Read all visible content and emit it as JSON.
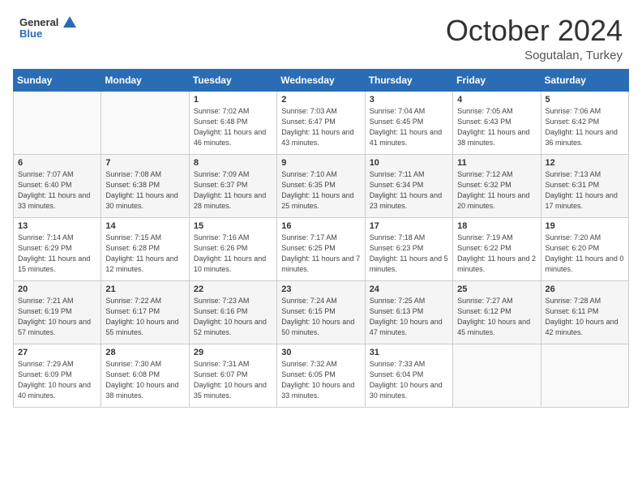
{
  "header": {
    "logo_general": "General",
    "logo_blue": "Blue",
    "title": "October 2024",
    "location": "Sogutalan, Turkey"
  },
  "weekdays": [
    "Sunday",
    "Monday",
    "Tuesday",
    "Wednesday",
    "Thursday",
    "Friday",
    "Saturday"
  ],
  "weeks": [
    [
      {
        "day": "",
        "sunrise": "",
        "sunset": "",
        "daylight": ""
      },
      {
        "day": "",
        "sunrise": "",
        "sunset": "",
        "daylight": ""
      },
      {
        "day": "1",
        "sunrise": "Sunrise: 7:02 AM",
        "sunset": "Sunset: 6:48 PM",
        "daylight": "Daylight: 11 hours and 46 minutes."
      },
      {
        "day": "2",
        "sunrise": "Sunrise: 7:03 AM",
        "sunset": "Sunset: 6:47 PM",
        "daylight": "Daylight: 11 hours and 43 minutes."
      },
      {
        "day": "3",
        "sunrise": "Sunrise: 7:04 AM",
        "sunset": "Sunset: 6:45 PM",
        "daylight": "Daylight: 11 hours and 41 minutes."
      },
      {
        "day": "4",
        "sunrise": "Sunrise: 7:05 AM",
        "sunset": "Sunset: 6:43 PM",
        "daylight": "Daylight: 11 hours and 38 minutes."
      },
      {
        "day": "5",
        "sunrise": "Sunrise: 7:06 AM",
        "sunset": "Sunset: 6:42 PM",
        "daylight": "Daylight: 11 hours and 36 minutes."
      }
    ],
    [
      {
        "day": "6",
        "sunrise": "Sunrise: 7:07 AM",
        "sunset": "Sunset: 6:40 PM",
        "daylight": "Daylight: 11 hours and 33 minutes."
      },
      {
        "day": "7",
        "sunrise": "Sunrise: 7:08 AM",
        "sunset": "Sunset: 6:38 PM",
        "daylight": "Daylight: 11 hours and 30 minutes."
      },
      {
        "day": "8",
        "sunrise": "Sunrise: 7:09 AM",
        "sunset": "Sunset: 6:37 PM",
        "daylight": "Daylight: 11 hours and 28 minutes."
      },
      {
        "day": "9",
        "sunrise": "Sunrise: 7:10 AM",
        "sunset": "Sunset: 6:35 PM",
        "daylight": "Daylight: 11 hours and 25 minutes."
      },
      {
        "day": "10",
        "sunrise": "Sunrise: 7:11 AM",
        "sunset": "Sunset: 6:34 PM",
        "daylight": "Daylight: 11 hours and 23 minutes."
      },
      {
        "day": "11",
        "sunrise": "Sunrise: 7:12 AM",
        "sunset": "Sunset: 6:32 PM",
        "daylight": "Daylight: 11 hours and 20 minutes."
      },
      {
        "day": "12",
        "sunrise": "Sunrise: 7:13 AM",
        "sunset": "Sunset: 6:31 PM",
        "daylight": "Daylight: 11 hours and 17 minutes."
      }
    ],
    [
      {
        "day": "13",
        "sunrise": "Sunrise: 7:14 AM",
        "sunset": "Sunset: 6:29 PM",
        "daylight": "Daylight: 11 hours and 15 minutes."
      },
      {
        "day": "14",
        "sunrise": "Sunrise: 7:15 AM",
        "sunset": "Sunset: 6:28 PM",
        "daylight": "Daylight: 11 hours and 12 minutes."
      },
      {
        "day": "15",
        "sunrise": "Sunrise: 7:16 AM",
        "sunset": "Sunset: 6:26 PM",
        "daylight": "Daylight: 11 hours and 10 minutes."
      },
      {
        "day": "16",
        "sunrise": "Sunrise: 7:17 AM",
        "sunset": "Sunset: 6:25 PM",
        "daylight": "Daylight: 11 hours and 7 minutes."
      },
      {
        "day": "17",
        "sunrise": "Sunrise: 7:18 AM",
        "sunset": "Sunset: 6:23 PM",
        "daylight": "Daylight: 11 hours and 5 minutes."
      },
      {
        "day": "18",
        "sunrise": "Sunrise: 7:19 AM",
        "sunset": "Sunset: 6:22 PM",
        "daylight": "Daylight: 11 hours and 2 minutes."
      },
      {
        "day": "19",
        "sunrise": "Sunrise: 7:20 AM",
        "sunset": "Sunset: 6:20 PM",
        "daylight": "Daylight: 11 hours and 0 minutes."
      }
    ],
    [
      {
        "day": "20",
        "sunrise": "Sunrise: 7:21 AM",
        "sunset": "Sunset: 6:19 PM",
        "daylight": "Daylight: 10 hours and 57 minutes."
      },
      {
        "day": "21",
        "sunrise": "Sunrise: 7:22 AM",
        "sunset": "Sunset: 6:17 PM",
        "daylight": "Daylight: 10 hours and 55 minutes."
      },
      {
        "day": "22",
        "sunrise": "Sunrise: 7:23 AM",
        "sunset": "Sunset: 6:16 PM",
        "daylight": "Daylight: 10 hours and 52 minutes."
      },
      {
        "day": "23",
        "sunrise": "Sunrise: 7:24 AM",
        "sunset": "Sunset: 6:15 PM",
        "daylight": "Daylight: 10 hours and 50 minutes."
      },
      {
        "day": "24",
        "sunrise": "Sunrise: 7:25 AM",
        "sunset": "Sunset: 6:13 PM",
        "daylight": "Daylight: 10 hours and 47 minutes."
      },
      {
        "day": "25",
        "sunrise": "Sunrise: 7:27 AM",
        "sunset": "Sunset: 6:12 PM",
        "daylight": "Daylight: 10 hours and 45 minutes."
      },
      {
        "day": "26",
        "sunrise": "Sunrise: 7:28 AM",
        "sunset": "Sunset: 6:11 PM",
        "daylight": "Daylight: 10 hours and 42 minutes."
      }
    ],
    [
      {
        "day": "27",
        "sunrise": "Sunrise: 7:29 AM",
        "sunset": "Sunset: 6:09 PM",
        "daylight": "Daylight: 10 hours and 40 minutes."
      },
      {
        "day": "28",
        "sunrise": "Sunrise: 7:30 AM",
        "sunset": "Sunset: 6:08 PM",
        "daylight": "Daylight: 10 hours and 38 minutes."
      },
      {
        "day": "29",
        "sunrise": "Sunrise: 7:31 AM",
        "sunset": "Sunset: 6:07 PM",
        "daylight": "Daylight: 10 hours and 35 minutes."
      },
      {
        "day": "30",
        "sunrise": "Sunrise: 7:32 AM",
        "sunset": "Sunset: 6:05 PM",
        "daylight": "Daylight: 10 hours and 33 minutes."
      },
      {
        "day": "31",
        "sunrise": "Sunrise: 7:33 AM",
        "sunset": "Sunset: 6:04 PM",
        "daylight": "Daylight: 10 hours and 30 minutes."
      },
      {
        "day": "",
        "sunrise": "",
        "sunset": "",
        "daylight": ""
      },
      {
        "day": "",
        "sunrise": "",
        "sunset": "",
        "daylight": ""
      }
    ]
  ]
}
